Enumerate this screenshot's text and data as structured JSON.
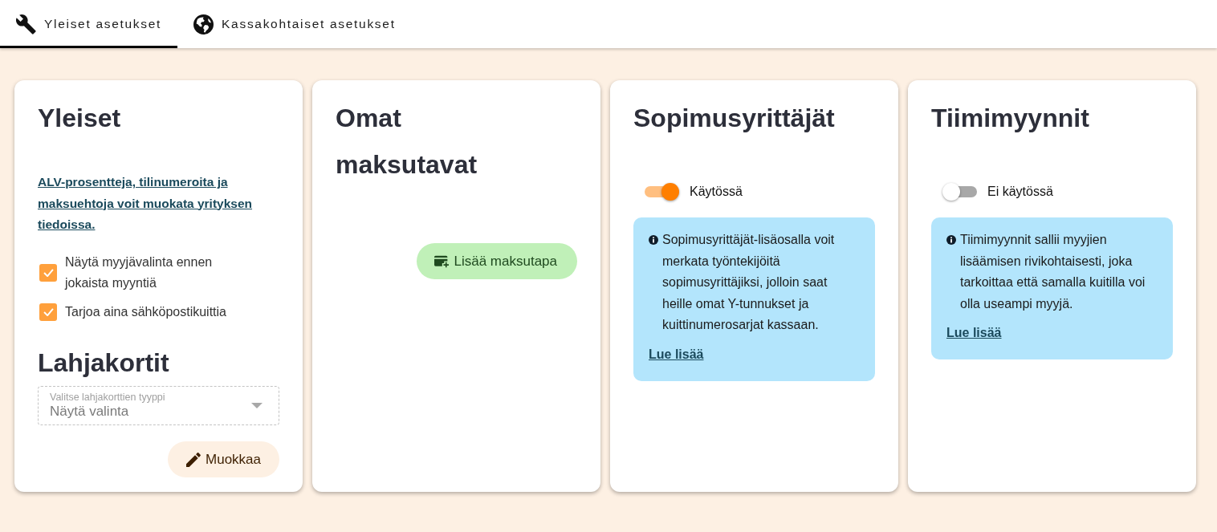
{
  "tabs": [
    {
      "label": "Yleiset asetukset",
      "selected": true
    },
    {
      "label": "Kassakohtaiset asetukset",
      "selected": false
    }
  ],
  "cards": [
    {
      "kind": "general",
      "title": "Yleiset",
      "link": "ALV-prosentteja, tilinumeroita ja maksuehtoja voit muokata yrityksen tiedoissa.",
      "checkboxes": [
        {
          "label": "Näytä myyjävalinta ennen jokaista myyntiä",
          "checked": true
        },
        {
          "label": "Tarjoa aina sähköpostikuittia",
          "checked": true
        }
      ],
      "subtitle": "Lahjakortit",
      "select": {
        "label": "Valitse lahjakorttien tyyppi",
        "value": "Näytä valinta",
        "disabled": true
      },
      "button": "Muokkaa"
    },
    {
      "kind": "payments",
      "title": "Omat maksutavat",
      "button": "Lisää maksutapa"
    },
    {
      "kind": "feature",
      "title": "Sopimusyrittäjät",
      "toggle": {
        "on": true,
        "label": "Käytössä"
      },
      "info": "Sopimusyrittäjät-lisäosalla voit merkata työntekijöitä sopimusyrittäjiksi, jolloin saat heille omat Y-tunnukset ja kuittinumerosarjat kassaan.",
      "link": "Lue lisää"
    },
    {
      "kind": "feature",
      "title": "Tiimimyynnit",
      "toggle": {
        "on": false,
        "label": "Ei käytössä"
      },
      "info": "Tiimimyynnit sallii myyjien lisäämisen rivikohtaisesti, joka tarkoittaa että samalla kuitilla voi olla useampi myyjä.",
      "link": "Lue lisää"
    }
  ]
}
